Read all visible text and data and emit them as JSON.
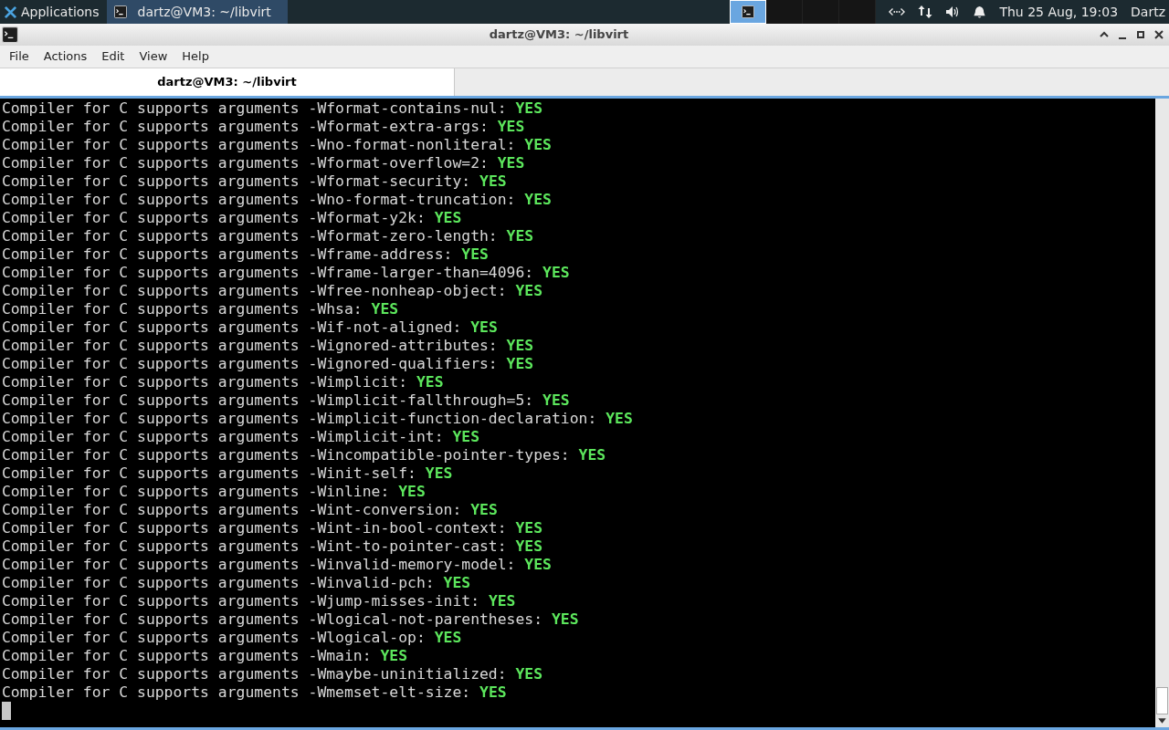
{
  "panel": {
    "menu": "Applications",
    "tasks": [
      {
        "label": "dartz@VM3: ~/libvirt",
        "selected": true
      }
    ],
    "workspaces": [
      {
        "selected": true
      },
      {
        "selected": false
      },
      {
        "selected": false
      },
      {
        "selected": false
      }
    ],
    "clock": "Thu 25 Aug, 19:03",
    "user": "Dartz"
  },
  "window": {
    "title": "dartz@VM3: ~/libvirt"
  },
  "menu": [
    "File",
    "Actions",
    "Edit",
    "View",
    "Help"
  ],
  "tabs": [
    {
      "label": "dartz@VM3: ~/libvirt",
      "selected": true
    }
  ],
  "lines": [
    {
      "text": "Compiler for C supports arguments -Wformat-contains-nul: ",
      "result": "YES"
    },
    {
      "text": "Compiler for C supports arguments -Wformat-extra-args: ",
      "result": "YES"
    },
    {
      "text": "Compiler for C supports arguments -Wno-format-nonliteral: ",
      "result": "YES"
    },
    {
      "text": "Compiler for C supports arguments -Wformat-overflow=2: ",
      "result": "YES"
    },
    {
      "text": "Compiler for C supports arguments -Wformat-security: ",
      "result": "YES"
    },
    {
      "text": "Compiler for C supports arguments -Wno-format-truncation: ",
      "result": "YES"
    },
    {
      "text": "Compiler for C supports arguments -Wformat-y2k: ",
      "result": "YES"
    },
    {
      "text": "Compiler for C supports arguments -Wformat-zero-length: ",
      "result": "YES"
    },
    {
      "text": "Compiler for C supports arguments -Wframe-address: ",
      "result": "YES"
    },
    {
      "text": "Compiler for C supports arguments -Wframe-larger-than=4096: ",
      "result": "YES"
    },
    {
      "text": "Compiler for C supports arguments -Wfree-nonheap-object: ",
      "result": "YES"
    },
    {
      "text": "Compiler for C supports arguments -Whsa: ",
      "result": "YES"
    },
    {
      "text": "Compiler for C supports arguments -Wif-not-aligned: ",
      "result": "YES"
    },
    {
      "text": "Compiler for C supports arguments -Wignored-attributes: ",
      "result": "YES"
    },
    {
      "text": "Compiler for C supports arguments -Wignored-qualifiers: ",
      "result": "YES"
    },
    {
      "text": "Compiler for C supports arguments -Wimplicit: ",
      "result": "YES"
    },
    {
      "text": "Compiler for C supports arguments -Wimplicit-fallthrough=5: ",
      "result": "YES"
    },
    {
      "text": "Compiler for C supports arguments -Wimplicit-function-declaration: ",
      "result": "YES"
    },
    {
      "text": "Compiler for C supports arguments -Wimplicit-int: ",
      "result": "YES"
    },
    {
      "text": "Compiler for C supports arguments -Wincompatible-pointer-types: ",
      "result": "YES"
    },
    {
      "text": "Compiler for C supports arguments -Winit-self: ",
      "result": "YES"
    },
    {
      "text": "Compiler for C supports arguments -Winline: ",
      "result": "YES"
    },
    {
      "text": "Compiler for C supports arguments -Wint-conversion: ",
      "result": "YES"
    },
    {
      "text": "Compiler for C supports arguments -Wint-in-bool-context: ",
      "result": "YES"
    },
    {
      "text": "Compiler for C supports arguments -Wint-to-pointer-cast: ",
      "result": "YES"
    },
    {
      "text": "Compiler for C supports arguments -Winvalid-memory-model: ",
      "result": "YES"
    },
    {
      "text": "Compiler for C supports arguments -Winvalid-pch: ",
      "result": "YES"
    },
    {
      "text": "Compiler for C supports arguments -Wjump-misses-init: ",
      "result": "YES"
    },
    {
      "text": "Compiler for C supports arguments -Wlogical-not-parentheses: ",
      "result": "YES"
    },
    {
      "text": "Compiler for C supports arguments -Wlogical-op: ",
      "result": "YES"
    },
    {
      "text": "Compiler for C supports arguments -Wmain: ",
      "result": "YES"
    },
    {
      "text": "Compiler for C supports arguments -Wmaybe-uninitialized: ",
      "result": "YES"
    },
    {
      "text": "Compiler for C supports arguments -Wmemset-elt-size: ",
      "result": "YES"
    }
  ]
}
